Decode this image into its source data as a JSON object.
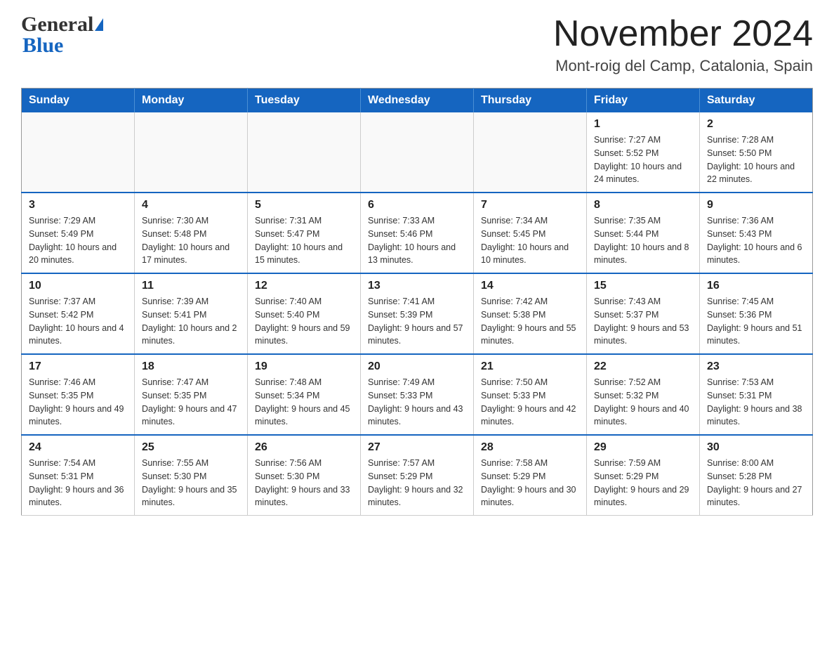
{
  "header": {
    "logo_general": "General",
    "logo_blue": "Blue",
    "month_title": "November 2024",
    "location": "Mont-roig del Camp, Catalonia, Spain"
  },
  "weekdays": [
    "Sunday",
    "Monday",
    "Tuesday",
    "Wednesday",
    "Thursday",
    "Friday",
    "Saturday"
  ],
  "weeks": [
    [
      {
        "day": "",
        "sunrise": "",
        "sunset": "",
        "daylight": ""
      },
      {
        "day": "",
        "sunrise": "",
        "sunset": "",
        "daylight": ""
      },
      {
        "day": "",
        "sunrise": "",
        "sunset": "",
        "daylight": ""
      },
      {
        "day": "",
        "sunrise": "",
        "sunset": "",
        "daylight": ""
      },
      {
        "day": "",
        "sunrise": "",
        "sunset": "",
        "daylight": ""
      },
      {
        "day": "1",
        "sunrise": "Sunrise: 7:27 AM",
        "sunset": "Sunset: 5:52 PM",
        "daylight": "Daylight: 10 hours and 24 minutes."
      },
      {
        "day": "2",
        "sunrise": "Sunrise: 7:28 AM",
        "sunset": "Sunset: 5:50 PM",
        "daylight": "Daylight: 10 hours and 22 minutes."
      }
    ],
    [
      {
        "day": "3",
        "sunrise": "Sunrise: 7:29 AM",
        "sunset": "Sunset: 5:49 PM",
        "daylight": "Daylight: 10 hours and 20 minutes."
      },
      {
        "day": "4",
        "sunrise": "Sunrise: 7:30 AM",
        "sunset": "Sunset: 5:48 PM",
        "daylight": "Daylight: 10 hours and 17 minutes."
      },
      {
        "day": "5",
        "sunrise": "Sunrise: 7:31 AM",
        "sunset": "Sunset: 5:47 PM",
        "daylight": "Daylight: 10 hours and 15 minutes."
      },
      {
        "day": "6",
        "sunrise": "Sunrise: 7:33 AM",
        "sunset": "Sunset: 5:46 PM",
        "daylight": "Daylight: 10 hours and 13 minutes."
      },
      {
        "day": "7",
        "sunrise": "Sunrise: 7:34 AM",
        "sunset": "Sunset: 5:45 PM",
        "daylight": "Daylight: 10 hours and 10 minutes."
      },
      {
        "day": "8",
        "sunrise": "Sunrise: 7:35 AM",
        "sunset": "Sunset: 5:44 PM",
        "daylight": "Daylight: 10 hours and 8 minutes."
      },
      {
        "day": "9",
        "sunrise": "Sunrise: 7:36 AM",
        "sunset": "Sunset: 5:43 PM",
        "daylight": "Daylight: 10 hours and 6 minutes."
      }
    ],
    [
      {
        "day": "10",
        "sunrise": "Sunrise: 7:37 AM",
        "sunset": "Sunset: 5:42 PM",
        "daylight": "Daylight: 10 hours and 4 minutes."
      },
      {
        "day": "11",
        "sunrise": "Sunrise: 7:39 AM",
        "sunset": "Sunset: 5:41 PM",
        "daylight": "Daylight: 10 hours and 2 minutes."
      },
      {
        "day": "12",
        "sunrise": "Sunrise: 7:40 AM",
        "sunset": "Sunset: 5:40 PM",
        "daylight": "Daylight: 9 hours and 59 minutes."
      },
      {
        "day": "13",
        "sunrise": "Sunrise: 7:41 AM",
        "sunset": "Sunset: 5:39 PM",
        "daylight": "Daylight: 9 hours and 57 minutes."
      },
      {
        "day": "14",
        "sunrise": "Sunrise: 7:42 AM",
        "sunset": "Sunset: 5:38 PM",
        "daylight": "Daylight: 9 hours and 55 minutes."
      },
      {
        "day": "15",
        "sunrise": "Sunrise: 7:43 AM",
        "sunset": "Sunset: 5:37 PM",
        "daylight": "Daylight: 9 hours and 53 minutes."
      },
      {
        "day": "16",
        "sunrise": "Sunrise: 7:45 AM",
        "sunset": "Sunset: 5:36 PM",
        "daylight": "Daylight: 9 hours and 51 minutes."
      }
    ],
    [
      {
        "day": "17",
        "sunrise": "Sunrise: 7:46 AM",
        "sunset": "Sunset: 5:35 PM",
        "daylight": "Daylight: 9 hours and 49 minutes."
      },
      {
        "day": "18",
        "sunrise": "Sunrise: 7:47 AM",
        "sunset": "Sunset: 5:35 PM",
        "daylight": "Daylight: 9 hours and 47 minutes."
      },
      {
        "day": "19",
        "sunrise": "Sunrise: 7:48 AM",
        "sunset": "Sunset: 5:34 PM",
        "daylight": "Daylight: 9 hours and 45 minutes."
      },
      {
        "day": "20",
        "sunrise": "Sunrise: 7:49 AM",
        "sunset": "Sunset: 5:33 PM",
        "daylight": "Daylight: 9 hours and 43 minutes."
      },
      {
        "day": "21",
        "sunrise": "Sunrise: 7:50 AM",
        "sunset": "Sunset: 5:33 PM",
        "daylight": "Daylight: 9 hours and 42 minutes."
      },
      {
        "day": "22",
        "sunrise": "Sunrise: 7:52 AM",
        "sunset": "Sunset: 5:32 PM",
        "daylight": "Daylight: 9 hours and 40 minutes."
      },
      {
        "day": "23",
        "sunrise": "Sunrise: 7:53 AM",
        "sunset": "Sunset: 5:31 PM",
        "daylight": "Daylight: 9 hours and 38 minutes."
      }
    ],
    [
      {
        "day": "24",
        "sunrise": "Sunrise: 7:54 AM",
        "sunset": "Sunset: 5:31 PM",
        "daylight": "Daylight: 9 hours and 36 minutes."
      },
      {
        "day": "25",
        "sunrise": "Sunrise: 7:55 AM",
        "sunset": "Sunset: 5:30 PM",
        "daylight": "Daylight: 9 hours and 35 minutes."
      },
      {
        "day": "26",
        "sunrise": "Sunrise: 7:56 AM",
        "sunset": "Sunset: 5:30 PM",
        "daylight": "Daylight: 9 hours and 33 minutes."
      },
      {
        "day": "27",
        "sunrise": "Sunrise: 7:57 AM",
        "sunset": "Sunset: 5:29 PM",
        "daylight": "Daylight: 9 hours and 32 minutes."
      },
      {
        "day": "28",
        "sunrise": "Sunrise: 7:58 AM",
        "sunset": "Sunset: 5:29 PM",
        "daylight": "Daylight: 9 hours and 30 minutes."
      },
      {
        "day": "29",
        "sunrise": "Sunrise: 7:59 AM",
        "sunset": "Sunset: 5:29 PM",
        "daylight": "Daylight: 9 hours and 29 minutes."
      },
      {
        "day": "30",
        "sunrise": "Sunrise: 8:00 AM",
        "sunset": "Sunset: 5:28 PM",
        "daylight": "Daylight: 9 hours and 27 minutes."
      }
    ]
  ]
}
